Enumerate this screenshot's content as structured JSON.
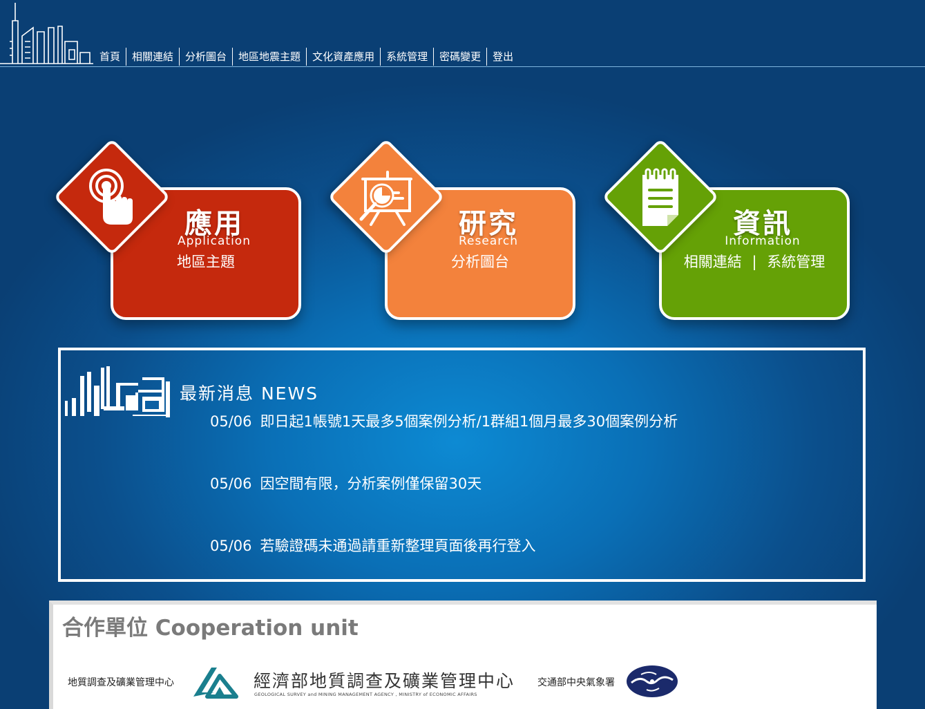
{
  "nav": [
    {
      "label": "首頁"
    },
    {
      "label": "相關連結"
    },
    {
      "label": "分析圖台"
    },
    {
      "label": "地區地震主題"
    },
    {
      "label": "文化資產應用"
    },
    {
      "label": "系統管理"
    },
    {
      "label": "密碼變更"
    },
    {
      "label": "登出"
    }
  ],
  "cards": {
    "application": {
      "title": "應用",
      "subtitle": "Application",
      "link": "地區主題",
      "color": "#c5290d"
    },
    "research": {
      "title": "研究",
      "subtitle": "Research",
      "link": "分析圖台",
      "color": "#f3823c"
    },
    "information": {
      "title": "資訊",
      "subtitle": "Information",
      "link1": "相關連結",
      "separator": "|",
      "link2": "系統管理",
      "color": "#65a106"
    }
  },
  "news": {
    "heading": "最新消息 NEWS",
    "items": [
      {
        "date": "05/06",
        "text": "即日起1帳號1天最多5個案例分析/1群組1個月最多30個案例分析"
      },
      {
        "date": "05/06",
        "text": "因空間有限，分析案例僅保留30天"
      },
      {
        "date": "05/06",
        "text": "若驗證碼未通過請重新整理頁面後再行登入"
      }
    ]
  },
  "cooperation": {
    "title": "合作單位 Cooperation unit",
    "partner1_label": "地質調查及礦業管理中心",
    "partner1_logo_name": "經濟部地質調查及礦業管理中心",
    "partner1_logo_en": "GEOLOGICAL SURVEY and MINING MANAGEMENT AGENCY , MINISTRY of ECONOMIC AFFAIRS",
    "partner2_label": "交通部中央氣象署"
  }
}
